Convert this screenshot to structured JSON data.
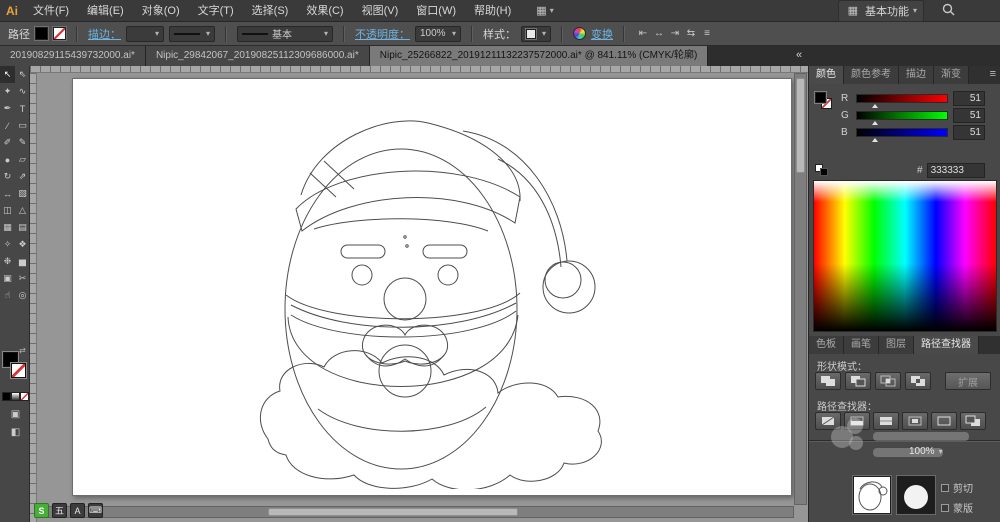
{
  "app": {
    "logo": "Ai"
  },
  "colors": {
    "accent_link": "#6fb3e0",
    "ime_green": "#45b035"
  },
  "ui": {
    "caret": "▾",
    "panel_menu_icon": "≡",
    "swap_icon": "⇄"
  },
  "menu_bar": {
    "items": [
      {
        "key": "file",
        "label": "文件(F)"
      },
      {
        "key": "edit",
        "label": "编辑(E)"
      },
      {
        "key": "object",
        "label": "对象(O)"
      },
      {
        "key": "type",
        "label": "文字(T)"
      },
      {
        "key": "select",
        "label": "选择(S)"
      },
      {
        "key": "effect",
        "label": "效果(C)"
      },
      {
        "key": "view",
        "label": "视图(V)"
      },
      {
        "key": "window",
        "label": "窗口(W)"
      },
      {
        "key": "help",
        "label": "帮助(H)"
      }
    ],
    "arrange_icon": "▦",
    "workspace_icon": "▦",
    "workspace_label": "基本功能"
  },
  "control_bar": {
    "context_label": "路径",
    "stroke_link": "描边：",
    "stroke_weight_value": "",
    "brush_label": "基本",
    "opacity_link": "不透明度：",
    "opacity_value": "100%",
    "style_label": "样式：",
    "transform_link": "变换",
    "align_icons": [
      {
        "name": "align-horizontal-left-icon",
        "glyph": "⇤"
      },
      {
        "name": "align-horizontal-center-icon",
        "glyph": "↔"
      },
      {
        "name": "align-horizontal-right-icon",
        "glyph": "⇥"
      },
      {
        "name": "distribute-icon",
        "glyph": "⇆"
      },
      {
        "name": "control-panel-menu-icon",
        "glyph": "≡"
      }
    ]
  },
  "document_tabs": [
    {
      "label": "20190829115439732000.ai*",
      "active": false
    },
    {
      "label": "Nipic_29842067_20190825112309686000.ai*",
      "active": false
    },
    {
      "label": "Nipic_25266822_20191211132237572000.ai* @ 841.11% (CMYK/轮廓)",
      "active": true
    }
  ],
  "dock": {
    "collapse_icon": "«"
  },
  "tools": [
    {
      "key": "selection",
      "glyph": "↖",
      "active": true
    },
    {
      "key": "direct-selection",
      "glyph": "⇖",
      "active": false
    },
    {
      "key": "magic-wand",
      "glyph": "✦"
    },
    {
      "key": "lasso",
      "glyph": "∿"
    },
    {
      "key": "pen",
      "glyph": "✒"
    },
    {
      "key": "type",
      "glyph": "T"
    },
    {
      "key": "line-segment",
      "glyph": "∕"
    },
    {
      "key": "rectangle",
      "glyph": "▭"
    },
    {
      "key": "paintbrush",
      "glyph": "✐"
    },
    {
      "key": "pencil",
      "glyph": "✎"
    },
    {
      "key": "blob-brush",
      "glyph": "●"
    },
    {
      "key": "eraser",
      "glyph": "▱"
    },
    {
      "key": "rotate",
      "glyph": "↻"
    },
    {
      "key": "scale",
      "glyph": "⇗"
    },
    {
      "key": "width",
      "glyph": "↔"
    },
    {
      "key": "free-transform",
      "glyph": "▧"
    },
    {
      "key": "shape-builder",
      "glyph": "◫"
    },
    {
      "key": "perspective-grid",
      "glyph": "△"
    },
    {
      "key": "mesh",
      "glyph": "▦"
    },
    {
      "key": "gradient",
      "glyph": "▤"
    },
    {
      "key": "eyedropper",
      "glyph": "✧"
    },
    {
      "key": "blend",
      "glyph": "❖"
    },
    {
      "key": "symbol-sprayer",
      "glyph": "❉"
    },
    {
      "key": "column-graph",
      "glyph": "▅"
    },
    {
      "key": "artboard",
      "glyph": "▣"
    },
    {
      "key": "slice",
      "glyph": "✂"
    },
    {
      "key": "hand",
      "glyph": "☝"
    },
    {
      "key": "zoom",
      "glyph": "◎"
    }
  ],
  "color_panel": {
    "tabs": [
      {
        "label": "颜色",
        "active": true
      },
      {
        "label": "颜色参考",
        "active": false
      },
      {
        "label": "描边",
        "active": false
      },
      {
        "label": "渐变",
        "active": false
      }
    ],
    "channels": [
      {
        "label": "R",
        "value": "51",
        "percent": 20
      },
      {
        "label": "G",
        "value": "51",
        "percent": 20
      },
      {
        "label": "B",
        "value": "51",
        "percent": 20
      }
    ],
    "hex_label": "#",
    "hex_value": "333333"
  },
  "panel_tabs_bottom": [
    {
      "label": "色板",
      "active": false
    },
    {
      "label": "画笔",
      "active": false
    },
    {
      "label": "图层",
      "active": false
    },
    {
      "label": "路径查找器",
      "active": true
    }
  ],
  "pathfinder_panel": {
    "shape_modes_label": "形状模式：",
    "shape_mode_buttons": [
      {
        "name": "unite"
      },
      {
        "name": "minus-front"
      },
      {
        "name": "intersect"
      },
      {
        "name": "exclude"
      }
    ],
    "expand_label": "扩展",
    "pathfinders_label": "路径查找器：",
    "pathfinder_buttons": [
      {
        "name": "divide"
      },
      {
        "name": "trim"
      },
      {
        "name": "merge"
      },
      {
        "name": "crop"
      },
      {
        "name": "outline"
      },
      {
        "name": "minus-back"
      }
    ]
  },
  "transparency_panel": {
    "opacity_value": "100%",
    "clip_label": "剪切",
    "mask_label": "蒙版"
  },
  "ime_bar": [
    {
      "name": "ime-logo-icon",
      "glyph": "S"
    },
    {
      "name": "ime-mode-icon",
      "glyph": "五"
    },
    {
      "name": "ime-lang-icon",
      "glyph": "A"
    },
    {
      "name": "ime-keyboard-icon",
      "glyph": "⌨"
    }
  ]
}
